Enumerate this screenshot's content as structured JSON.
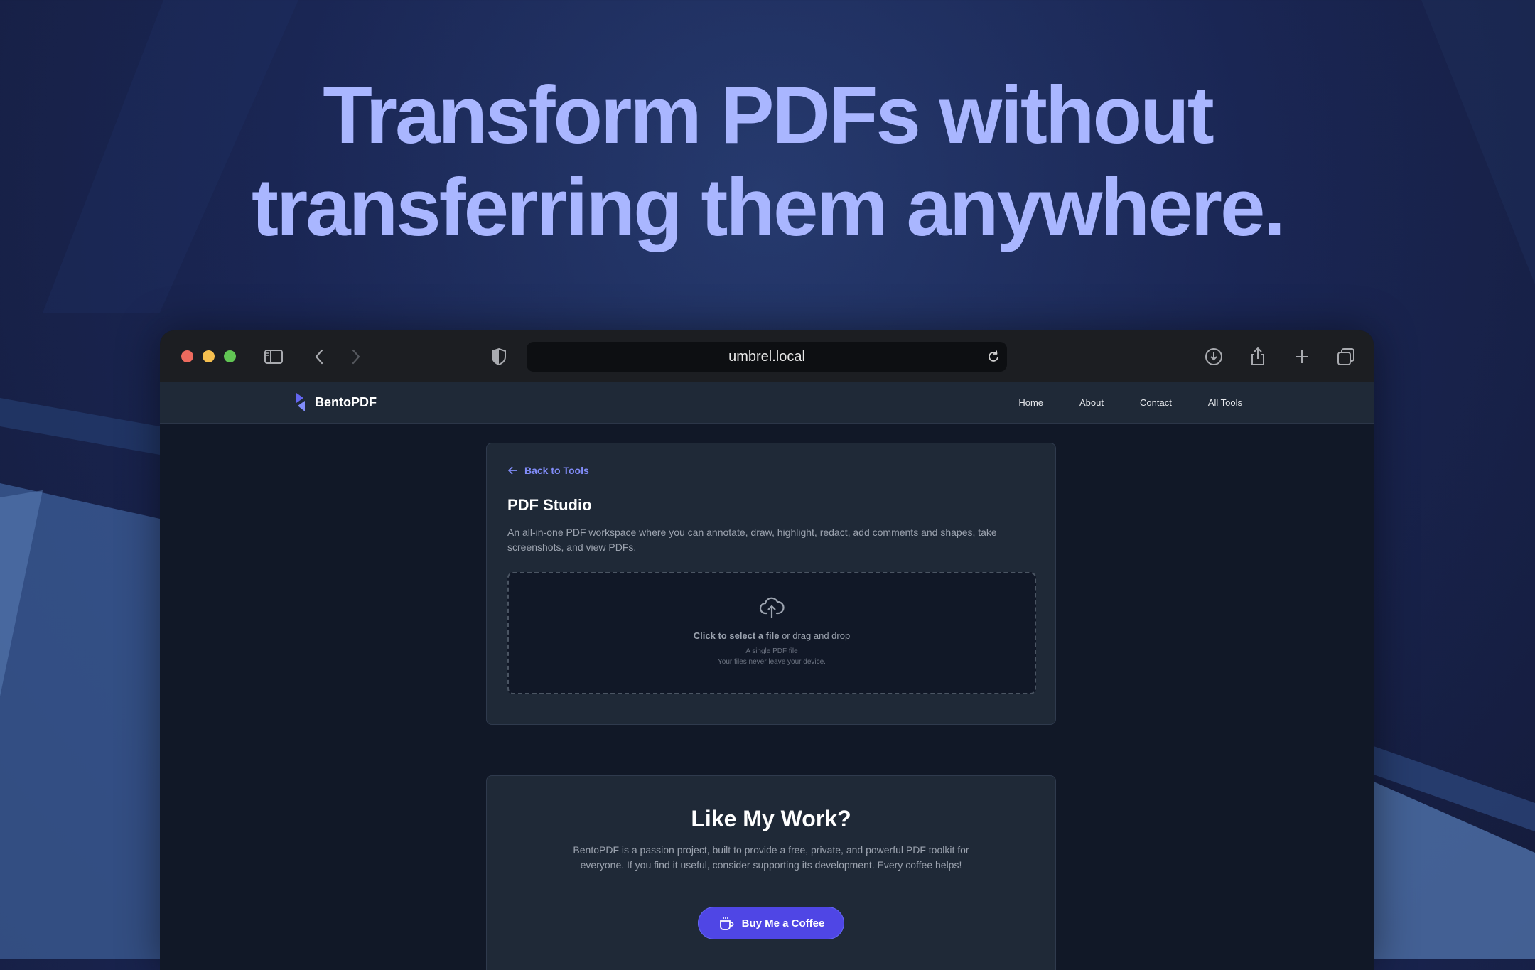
{
  "hero": {
    "line1": "Transform PDFs without",
    "line2": "transferring them anywhere."
  },
  "browser": {
    "url": "umbrel.local",
    "window_controls": [
      "close",
      "minimize",
      "zoom"
    ],
    "toolbar_icons": [
      "sidebar-icon",
      "back-icon",
      "forward-icon",
      "shield-icon",
      "reload-icon",
      "download-icon",
      "share-icon",
      "new-tab-icon",
      "tabs-overview-icon"
    ]
  },
  "site": {
    "brand": "BentoPDF",
    "nav": [
      {
        "label": "Home"
      },
      {
        "label": "About"
      },
      {
        "label": "Contact"
      },
      {
        "label": "All Tools"
      }
    ]
  },
  "tool": {
    "back_label": "Back to Tools",
    "title": "PDF Studio",
    "description": "An all-in-one PDF workspace where you can annotate, draw, highlight, redact, add comments and shapes, take screenshots, and view PDFs.",
    "dropzone": {
      "action_bold": "Click to select a file",
      "action_rest": " or drag and drop",
      "hint": "A single PDF file",
      "privacy": "Your files never leave your device."
    }
  },
  "support": {
    "title": "Like My Work?",
    "text": "BentoPDF is a passion project, built to provide a free, private, and powerful PDF toolkit for everyone. If you find it useful, consider supporting its development. Every coffee helps!",
    "button_label": "Buy Me a Coffee"
  },
  "colors": {
    "headline": "#a9b6ff",
    "accent": "#818cf8",
    "button": "#4f46e5",
    "traffic_red": "#ed6a5e",
    "traffic_yellow": "#f5bf4f",
    "traffic_green": "#61c554"
  }
}
